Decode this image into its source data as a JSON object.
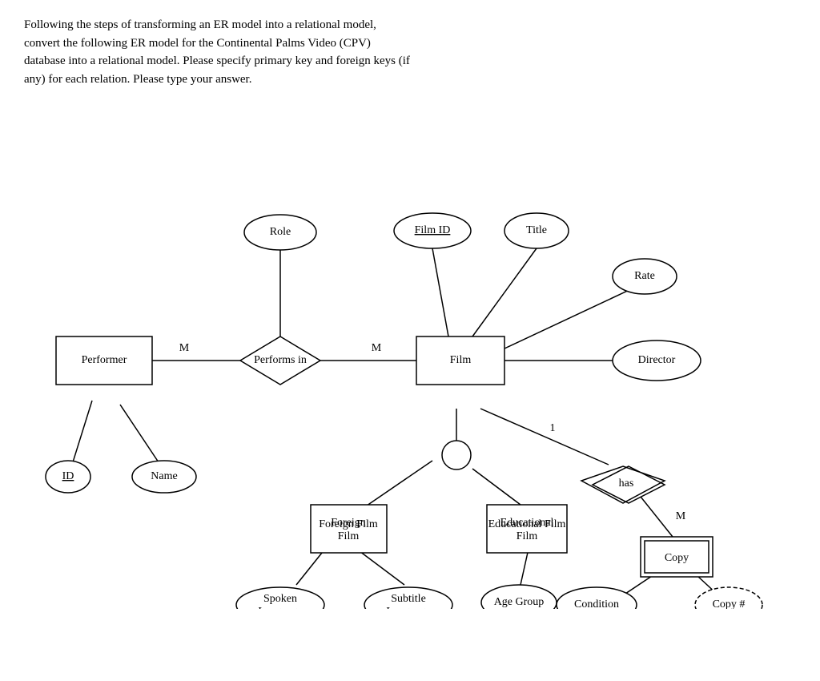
{
  "description": {
    "line1": "Following the steps of transforming an ER model into a relational model,",
    "line2": "convert the following ER model for the Continental Palms Video (CPV)",
    "line3": "database into a relational model. Please specify primary key and foreign keys (if",
    "line4": "any) for each relation. Please type your answer."
  },
  "nodes": {
    "performer": "Performer",
    "performs_in": "Performs in",
    "film": "Film",
    "role": "Role",
    "film_id": "Film ID",
    "title": "Title",
    "rate": "Rate",
    "director": "Director",
    "id": "ID",
    "name": "Name",
    "foreign_film": "Foreign Film",
    "educational_film": "Educational Film",
    "spoken_language": "Spoken Language",
    "subtitle_language": "Subtitle Language",
    "age_group": "Age Group",
    "has": "has",
    "copy": "Copy",
    "condition": "Condition",
    "copy_hash": "Copy #"
  },
  "labels": {
    "m1": "M",
    "m2": "M",
    "m3": "M",
    "one": "1"
  }
}
